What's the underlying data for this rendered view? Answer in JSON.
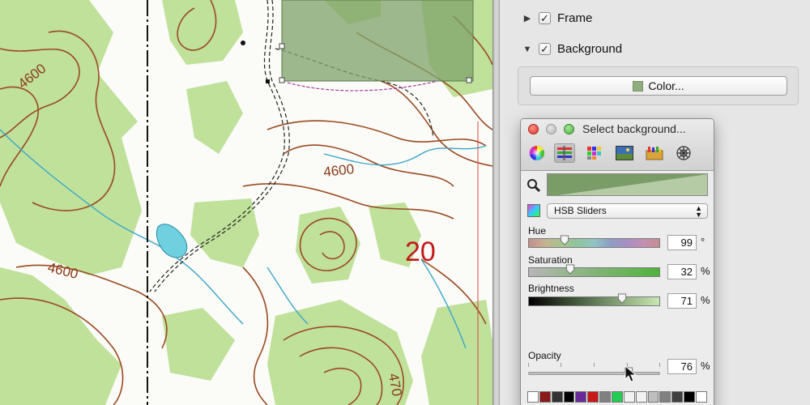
{
  "map": {
    "contour_labels": [
      "4600",
      "4600",
      "4600",
      "470"
    ],
    "section_number": "20"
  },
  "panel": {
    "frame_label": "Frame",
    "background_label": "Background",
    "color_button_label": "Color...",
    "background_color": "#8fb07c"
  },
  "picker": {
    "title": "Select background...",
    "mode_select": "HSB Sliders",
    "hue": {
      "label": "Hue",
      "value": "99",
      "unit": "°",
      "fraction": 0.275
    },
    "saturation": {
      "label": "Saturation",
      "value": "32",
      "unit": "%",
      "fraction": 0.32
    },
    "brightness": {
      "label": "Brightness",
      "value": "71",
      "unit": "%",
      "fraction": 0.71
    },
    "opacity": {
      "label": "Opacity",
      "value": "76",
      "unit": "%",
      "fraction": 0.76
    },
    "palette_colors": [
      "#ffffff",
      "#8b1a1a",
      "#333333",
      "#000000",
      "#6a2a9a",
      "#c91919",
      "#808080",
      "#22cc55",
      "#f2f2f2",
      "#f2f2f2",
      "#bfbfbf",
      "#808080",
      "#404040",
      "#000000",
      "#ffffff"
    ],
    "icons": [
      "color-wheel-icon",
      "color-sliders-icon",
      "color-palettes-icon",
      "image-palettes-icon",
      "crayons-icon",
      "web-colors-icon"
    ]
  }
}
